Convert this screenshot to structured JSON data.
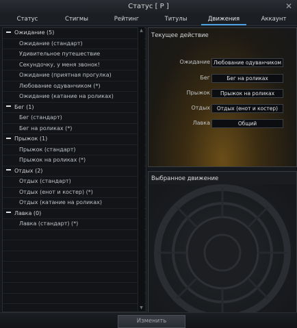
{
  "window": {
    "title": "Статус [ P ]",
    "close_label": "✕"
  },
  "tabs": [
    {
      "label": "Статус"
    },
    {
      "label": "Стигмы"
    },
    {
      "label": "Рейтинг"
    },
    {
      "label": "Титулы"
    },
    {
      "label": "Движения"
    },
    {
      "label": "Аккаунт"
    }
  ],
  "active_tab": "Движения",
  "emotes": {
    "groups": [
      {
        "label": "Ожидание (5)",
        "items": [
          "Ожидание (стандарт)",
          "Удивительное путешествие",
          "Секундочку, у меня звонок!",
          "Ожидание (приятная прогулка)",
          "Любование одуванчиком (*)",
          "Ожидание (катание на роликах)"
        ]
      },
      {
        "label": "Бег (1)",
        "items": [
          "Бег (стандарт)",
          "Бег на роликах (*)"
        ]
      },
      {
        "label": "Прыжок (1)",
        "items": [
          "Прыжок (стандарт)",
          "Прыжок на роликах (*)"
        ]
      },
      {
        "label": "Отдых (2)",
        "items": [
          "Отдых (стандарт)",
          "Отдых (енот и костер) (*)",
          "Отдых (катание на роликах)"
        ]
      },
      {
        "label": "Лавка (0)",
        "items": [
          "Лавка (стандарт) (*)"
        ]
      }
    ]
  },
  "current_action": {
    "heading": "Текущее действие",
    "rows": [
      {
        "label": "Ожидание",
        "value": "Любование одуванчиком"
      },
      {
        "label": "Бег",
        "value": "Бег на роликах"
      },
      {
        "label": "Прыжок",
        "value": "Прыжок на роликах"
      },
      {
        "label": "Отдых",
        "value": "Отдых (енот и костер)"
      },
      {
        "label": "Лавка",
        "value": "Общий"
      }
    ]
  },
  "selected_motion": {
    "heading": "Выбранное движение"
  },
  "buttons": {
    "change": "Изменить"
  }
}
